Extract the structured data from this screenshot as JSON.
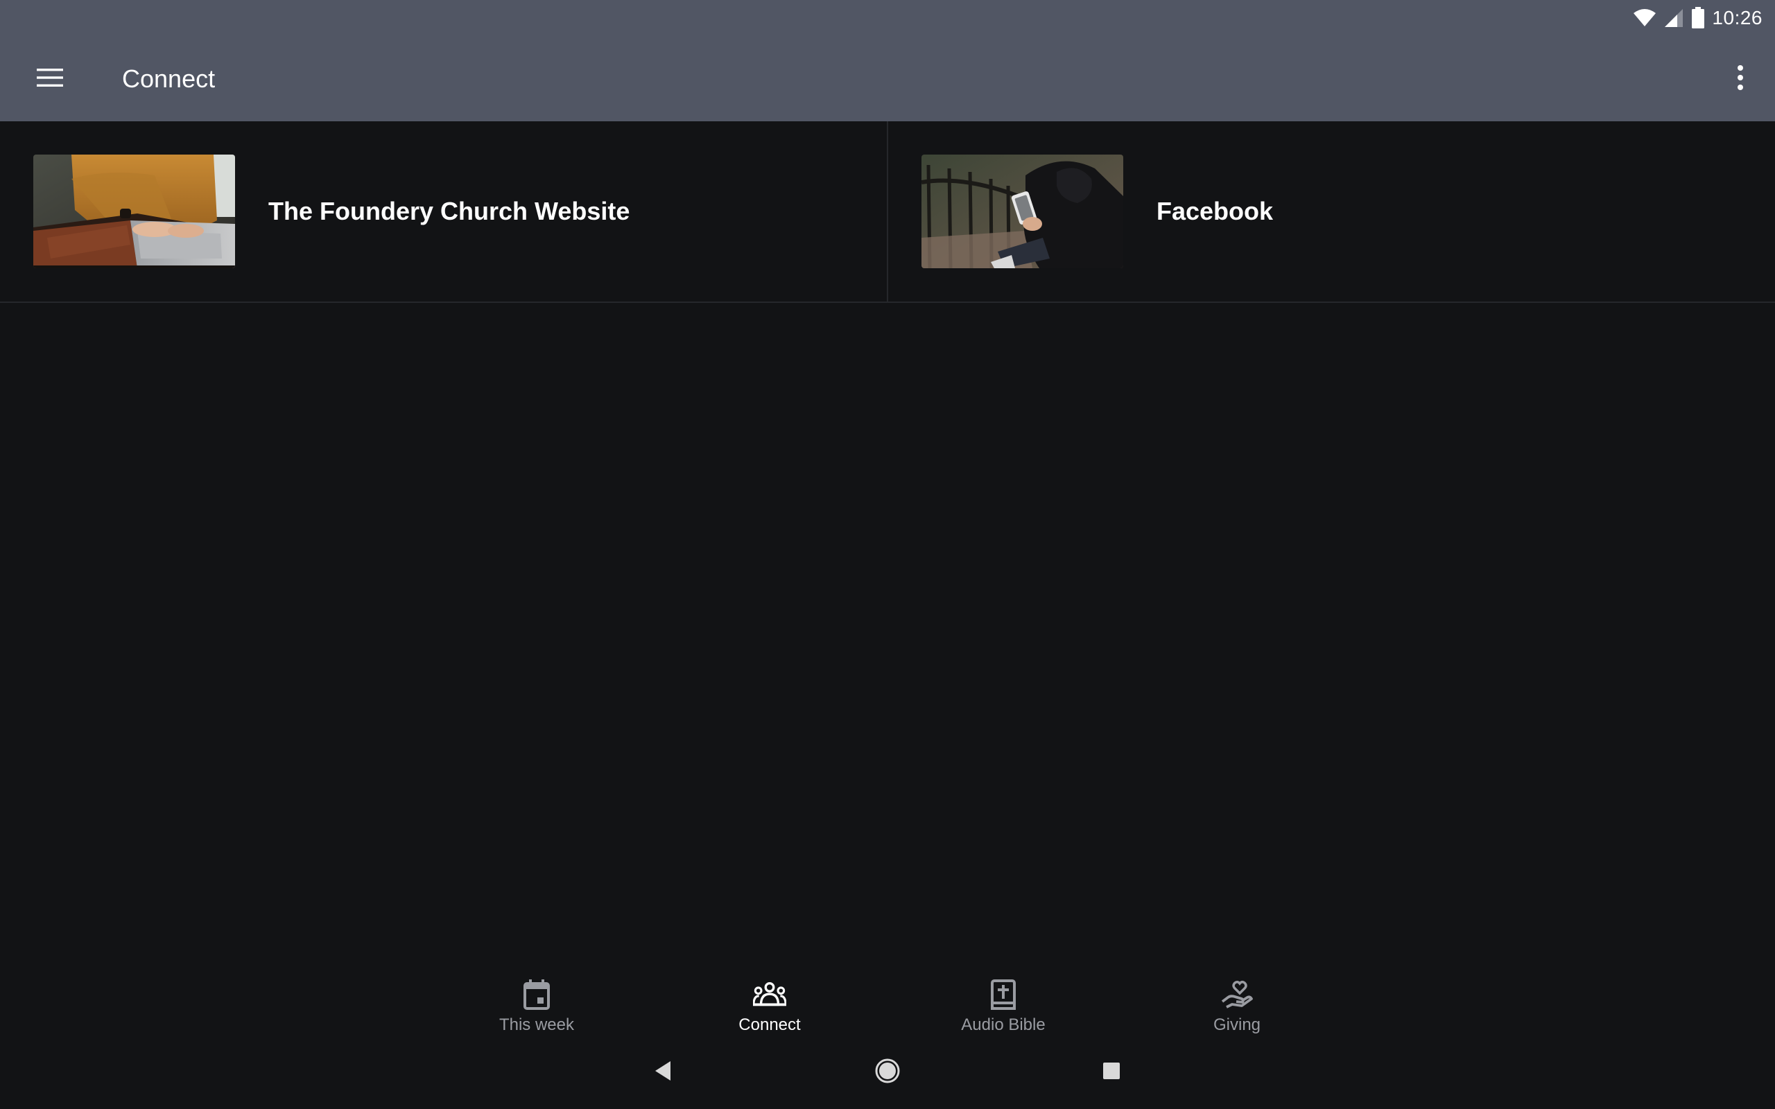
{
  "status_bar": {
    "time": "10:26",
    "icons": [
      "wifi-icon",
      "cellular-signal-icon",
      "battery-icon"
    ]
  },
  "app_bar": {
    "title": "Connect",
    "menu_icon": "hamburger-menu-icon",
    "overflow_icon": "more-vert-icon"
  },
  "cards": [
    {
      "title": "The Foundery Church Website",
      "image": "person-typing-on-laptop"
    },
    {
      "title": "Facebook",
      "image": "person-holding-phone-on-steps"
    }
  ],
  "bottom_nav": {
    "items": [
      {
        "label": "This week",
        "icon": "calendar-icon",
        "active": false
      },
      {
        "label": "Connect",
        "icon": "group-icon",
        "active": true
      },
      {
        "label": "Audio Bible",
        "icon": "bible-icon",
        "active": false
      },
      {
        "label": "Giving",
        "icon": "giving-hand-heart-icon",
        "active": false
      }
    ]
  },
  "system_nav": {
    "buttons": [
      "back-icon",
      "home-icon",
      "recents-icon"
    ]
  },
  "colors": {
    "app_bar": "#515664",
    "background": "#121315",
    "divider": "#25272b",
    "nav_inactive": "#9a9ca2",
    "nav_active": "#ffffff"
  }
}
